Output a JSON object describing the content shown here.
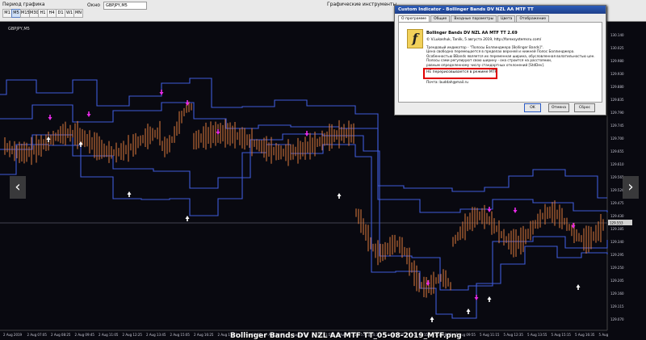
{
  "toolbar": {
    "period_label": "Период графика",
    "timeframes": [
      "M1",
      "M5",
      "M15",
      "M30",
      "H1",
      "H4",
      "D1",
      "W1",
      "MN"
    ],
    "active_timeframe": "M5",
    "search_label": "Окно",
    "search_value": "GBPJPY,M5",
    "instruments_label": "Графические инструменты"
  },
  "chart": {
    "symbol_tag": "GBPJPY,M5",
    "caption": "Bollinger Bands DV NZL AA MTF TT_05-08-2019_MTF.png",
    "colors": {
      "band": "#3f5bd8",
      "candle": "#e07a3c",
      "signal_up": "#ffffff",
      "signal_down": "#e829e8",
      "crosshair": "#555566"
    },
    "price_ticks": [
      "130.140",
      "130.025",
      "129.980",
      "129.930",
      "129.880",
      "129.835",
      "129.790",
      "129.745",
      "129.700",
      "129.655",
      "129.610",
      "129.565",
      "129.520",
      "129.475",
      "129.430",
      "129.385",
      "129.340",
      "129.295",
      "129.250",
      "129.205",
      "129.160",
      "129.115",
      "129.070"
    ],
    "current_price": "129.553",
    "time_ticks": [
      "2 Aug 2019",
      "2 Aug 07:05",
      "2 Aug 08:25",
      "2 Aug 09:45",
      "2 Aug 11:05",
      "2 Aug 12:25",
      "2 Aug 13:45",
      "2 Aug 15:05",
      "2 Aug 16:25",
      "2 Aug 17:45",
      "2 Aug 19:05",
      "2 Aug 20:25",
      "5 Aug 00:30",
      "5 Aug 01:55",
      "5 Aug 03:15",
      "5 Aug 04:35",
      "5 Aug 05:55",
      "5 Aug 07:15",
      "5 Aug 08:35",
      "5 Aug 09:55",
      "5 Aug 11:15",
      "5 Aug 12:35",
      "5 Aug 13:55",
      "5 Aug 15:15",
      "5 Aug 16:35",
      "5 Aug"
    ]
  },
  "dialog": {
    "title": "Custom Indicator - Bollinger Bands DV NZL AA MTF TT",
    "tabs": [
      "О программе",
      "Общие",
      "Входные параметры",
      "Цвета",
      "Отображение"
    ],
    "active_tab": "О программе",
    "indicator_name": "Bollinger Bands DV NZL AA MTF TT 2.69",
    "copyright": "© V.Lukashuk, Tanlik,   5 августа 2019,  http://forexsystemsru.com/",
    "description": [
      "Трендовый индикатор - \"Полосы Боллинджера [Bollinger Bands]\".",
      "Цена свободно перемещается в пределах верхней и нижней Полос Боллинджера.",
      "Особенностью BBands является их переменная ширина, обусловленная волатильностью цен.",
      "Полосы сами регулируют свою ширину - она строится на расстоянии,",
      "равным определенному числу стандартных отклонений [StdDev]."
    ],
    "note": "НЕ перерисовывается в режиме MTF",
    "email": "Почта:  buddah@mail.ru",
    "buttons": {
      "ok": "OK",
      "cancel": "Отмена",
      "reset": "Сброс"
    }
  }
}
